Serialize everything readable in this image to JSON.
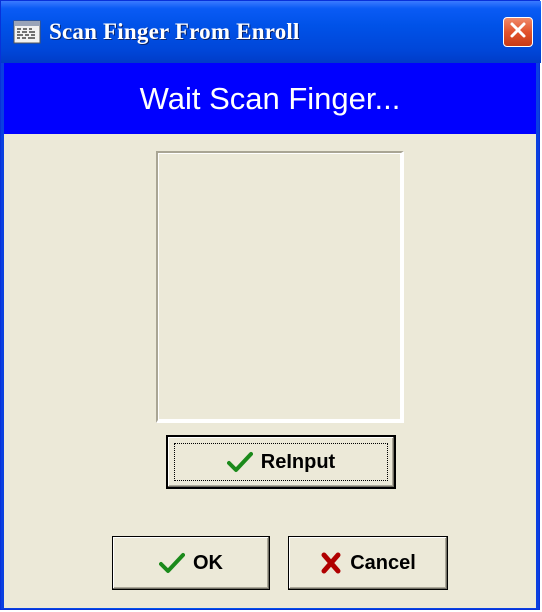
{
  "window": {
    "title": "Scan Finger From Enroll",
    "title_icon": "app-window-icon",
    "close_icon": "close-icon"
  },
  "banner": {
    "text": "Wait Scan Finger..."
  },
  "scan_area": {
    "content": ""
  },
  "buttons": {
    "reinput": {
      "label": "ReInput",
      "icon": "checkmark-icon"
    },
    "ok": {
      "label": "OK",
      "icon": "checkmark-icon"
    },
    "cancel": {
      "label": "Cancel",
      "icon": "x-icon"
    }
  },
  "colors": {
    "banner_bg": "#0000ff",
    "dialog_bg": "#ece9d8",
    "check_green": "#1b8a1b",
    "cancel_red": "#b00000"
  }
}
